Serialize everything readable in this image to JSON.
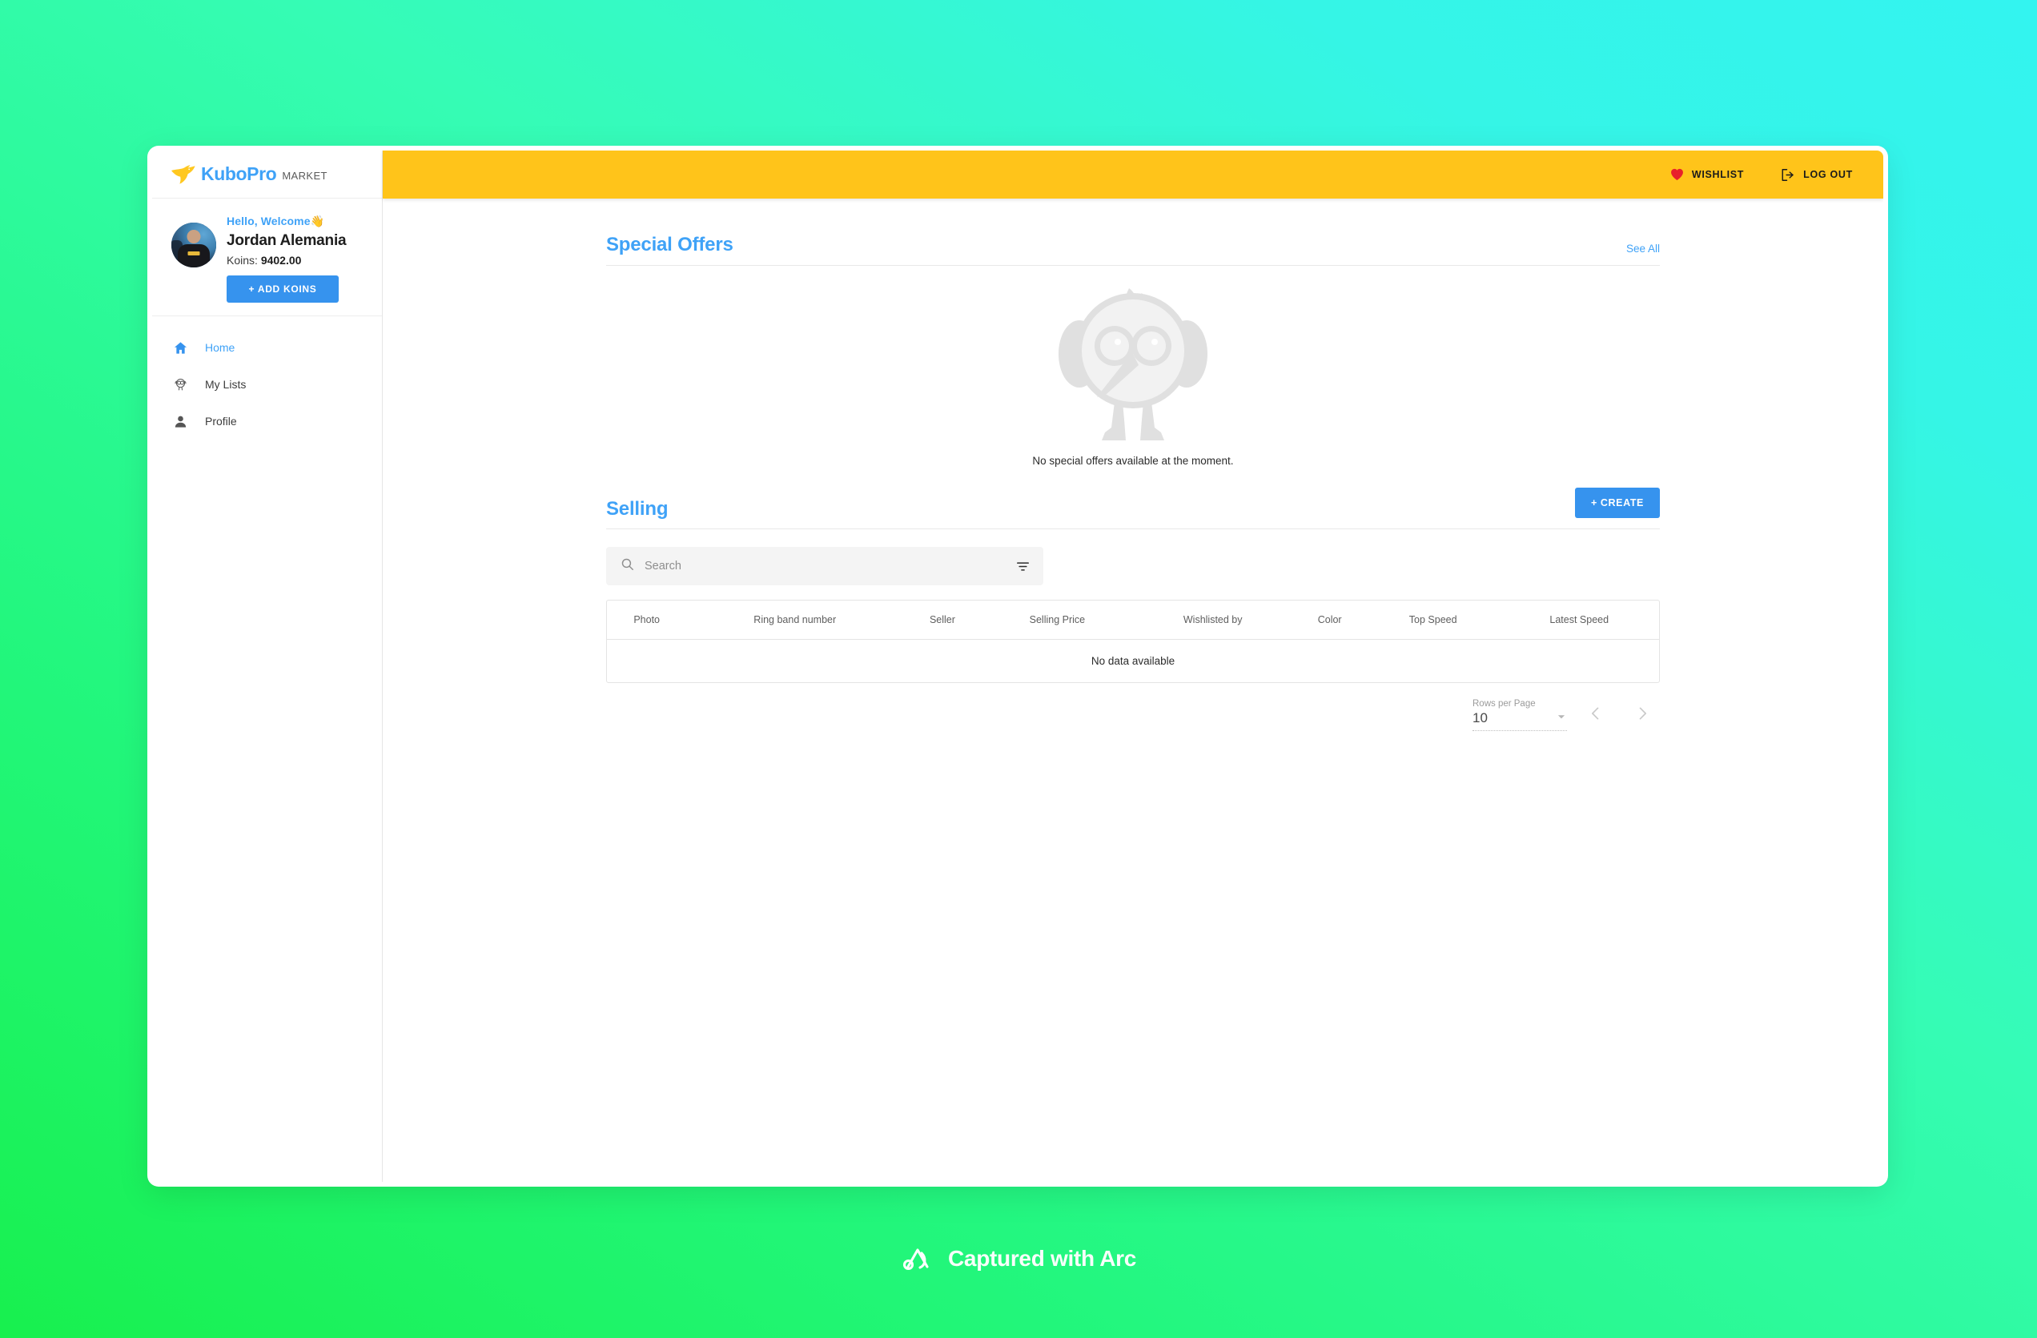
{
  "brand": {
    "name": "KuboPro",
    "suffix": "MARKET",
    "bird_icon": "dove-icon"
  },
  "profile": {
    "greeting": "Hello, Welcome",
    "wave_icon": "waving-hand-icon",
    "name": "Jordan Alemania",
    "koins_label": "Koins:",
    "koins_value": "9402.00",
    "add_koins_label": "+ ADD KOINS"
  },
  "sidebar": {
    "items": [
      {
        "label": "Home",
        "icon": "home-icon",
        "active": true
      },
      {
        "label": "My Lists",
        "icon": "bird-list-icon",
        "active": false
      },
      {
        "label": "Profile",
        "icon": "person-icon",
        "active": false
      }
    ]
  },
  "topbar": {
    "wishlist_label": "WISHLIST",
    "wishlist_icon": "heart-icon",
    "logout_label": "LOG OUT",
    "logout_icon": "logout-icon",
    "background_color": "#FFC41A"
  },
  "special_offers": {
    "title": "Special Offers",
    "see_all_label": "See All",
    "empty_message": "No special offers available at the moment.",
    "empty_illustration": "owl-mascot-icon"
  },
  "selling": {
    "title": "Selling",
    "create_label": "+ CREATE",
    "search_placeholder": "Search",
    "search_value": "",
    "search_icon": "search-icon",
    "filter_icon": "filter-icon",
    "columns": [
      "Photo",
      "Ring band number",
      "Seller",
      "Selling Price",
      "Wishlisted by",
      "Color",
      "Top Speed",
      "Latest Speed"
    ],
    "rows": [],
    "no_data_message": "No data available",
    "pagination": {
      "rows_per_page_label": "Rows per Page",
      "rows_per_page_value": "10",
      "prev_icon": "chevron-left-icon",
      "next_icon": "chevron-right-icon"
    }
  },
  "watermark": {
    "text": "Captured with Arc",
    "icon": "arc-logo-icon"
  },
  "colors": {
    "accent_blue": "#3693EE",
    "title_blue": "#3FA2F7",
    "yellow": "#FFC41A",
    "heart_red": "#E8212B"
  }
}
